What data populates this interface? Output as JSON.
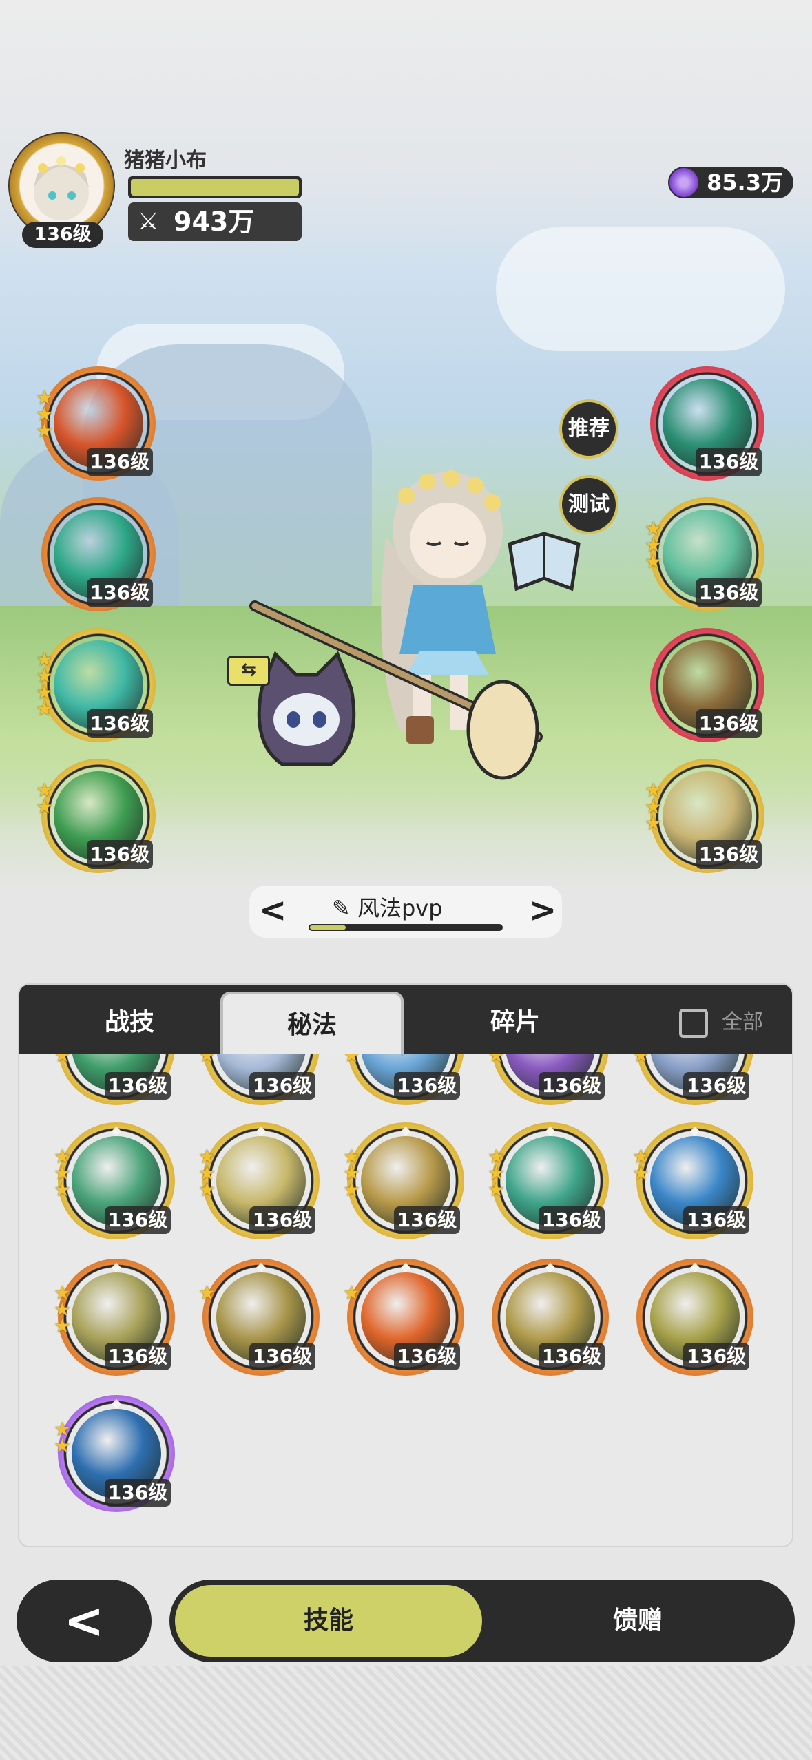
{
  "player": {
    "name": "猪猪小布",
    "level": "136级",
    "power": "943万",
    "power_icon": "crossed-swords-icon",
    "currency": "85.3万",
    "currency_icon": "purple-gem-icon"
  },
  "scene_skills": {
    "left": [
      {
        "level": "136级",
        "color": "#d6542a",
        "ring": "orange",
        "stars": 3
      },
      {
        "level": "136级",
        "color": "#2fa889",
        "ring": "orange",
        "stars": 0
      },
      {
        "level": "136级",
        "color": "#3fb8a5",
        "ring": "gold",
        "stars": 4
      },
      {
        "level": "136级",
        "color": "#3f9e52",
        "ring": "gold",
        "stars": 2
      }
    ],
    "right": [
      {
        "level": "136级",
        "color": "#2b8f74",
        "ring": "red",
        "stars": 0
      },
      {
        "level": "136级",
        "color": "#5fbf9c",
        "ring": "gold",
        "stars": 3
      },
      {
        "level": "136级",
        "color": "#8a6a3a",
        "ring": "red",
        "stars": 0
      },
      {
        "level": "136级",
        "color": "#c9b574",
        "ring": "gold",
        "stars": 3
      }
    ]
  },
  "side_buttons": {
    "recommend": "推荐",
    "test": "测试"
  },
  "preset": {
    "name": "风法pvp",
    "edit_icon": "pencil-icon",
    "prev_icon": "chevron-left-icon",
    "next_icon": "chevron-right-icon",
    "progress": 0.18
  },
  "panel": {
    "tabs": [
      "战技",
      "秘法",
      "碎片"
    ],
    "active_tab": 1,
    "show_all_label": "全部",
    "rows": [
      [
        {
          "level": "136级",
          "color": "#3f9e6a",
          "ring": "gold",
          "stars": 3
        },
        {
          "level": "136级",
          "color": "#a6b9d8",
          "ring": "gold",
          "stars": 3
        },
        {
          "level": "136级",
          "color": "#6aa6d8",
          "ring": "gold",
          "stars": 3
        },
        {
          "level": "136级",
          "color": "#8a5ac0",
          "ring": "gold",
          "stars": 3
        },
        {
          "level": "136级",
          "color": "#8aa0c8",
          "ring": "gold",
          "stars": 3
        }
      ],
      [
        {
          "level": "136级",
          "color": "#4aa47a",
          "ring": "gold",
          "stars": 3
        },
        {
          "level": "136级",
          "color": "#c7b86a",
          "ring": "gold",
          "stars": 3
        },
        {
          "level": "136级",
          "color": "#b89a4a",
          "ring": "gold",
          "stars": 3
        },
        {
          "level": "136级",
          "color": "#3fa58a",
          "ring": "gold",
          "stars": 3
        },
        {
          "level": "136级",
          "color": "#3a86c8",
          "ring": "gold",
          "stars": 2
        }
      ],
      [
        {
          "level": "136级",
          "color": "#a9a25a",
          "ring": "orange",
          "stars": 3
        },
        {
          "level": "136级",
          "color": "#a8954a",
          "ring": "orange",
          "stars": 1
        },
        {
          "level": "136级",
          "color": "#e0652a",
          "ring": "orange",
          "stars": 1
        },
        {
          "level": "136级",
          "color": "#b09a4a",
          "ring": "orange",
          "stars": 0
        },
        {
          "level": "136级",
          "color": "#a8a24a",
          "ring": "orange",
          "stars": 0
        }
      ],
      [
        {
          "level": "136级",
          "color": "#2e6fb0",
          "ring": "purple",
          "stars": 2
        }
      ]
    ]
  },
  "bottom": {
    "back_icon": "back-arrow-icon",
    "tab_on": "技能",
    "tab_off": "馈赠"
  }
}
